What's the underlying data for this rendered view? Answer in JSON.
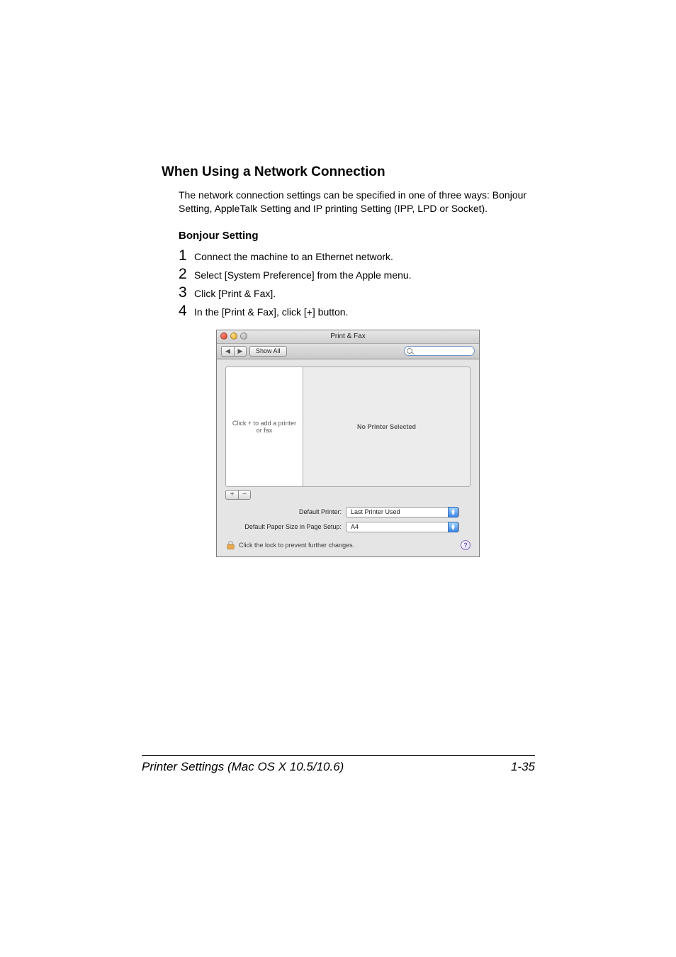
{
  "headings": {
    "main": "When Using a Network Connection",
    "sub": "Bonjour Setting"
  },
  "paragraph": "The network connection settings can be specified in one of three ways: Bonjour Setting, AppleTalk Setting and IP printing Setting (IPP, LPD or Socket).",
  "steps": [
    {
      "n": "1",
      "text": "Connect the machine to an Ethernet network."
    },
    {
      "n": "2",
      "text": "Select [System Preference] from the Apple menu."
    },
    {
      "n": "3",
      "text": "Click [Print & Fax]."
    },
    {
      "n": "4",
      "text": "In the [Print & Fax], click [+] button."
    }
  ],
  "window": {
    "title": "Print & Fax",
    "toolbar": {
      "show_all": "Show All",
      "search_placeholder": ""
    },
    "left_well_hint": "Click + to add a printer or fax",
    "right_well_message": "No Printer Selected",
    "add_label": "+",
    "remove_label": "−",
    "default_printer_label": "Default Printer:",
    "default_printer_value": "Last Printer Used",
    "paper_size_label": "Default Paper Size in Page Setup:",
    "paper_size_value": "A4",
    "lock_text": "Click the lock to prevent further changes.",
    "help_label": "?"
  },
  "footer": {
    "left": "Printer Settings (Mac OS X 10.5/10.6)",
    "right": "1-35"
  }
}
